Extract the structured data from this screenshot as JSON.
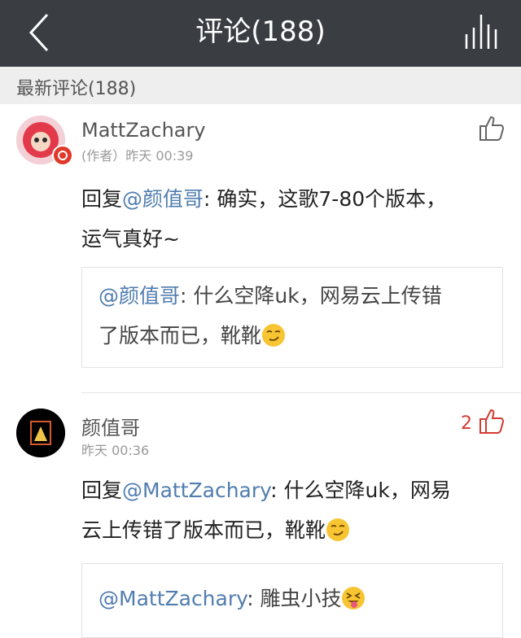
{
  "header": {
    "title": "评论(188)",
    "back_icon": "chevron-left-icon",
    "stats_icon": "bars-icon"
  },
  "section": {
    "label": "最新评论(188)"
  },
  "comments": [
    {
      "username": "MattZachary",
      "meta": "(作者）昨天 00:39",
      "like_count": "",
      "reply_prefix": "回复",
      "reply_mention": "@颜值哥",
      "reply_text_1": ": 确实，这歌7-80个版本，",
      "reply_text_2": "运气真好~",
      "quote_mention": "@颜值哥",
      "quote_text_1": ": 什么空降uk，网易云上传错",
      "quote_text_2": "了版本而已，靴靴",
      "quote_emoji": "smirk-emoji"
    },
    {
      "username": "颜值哥",
      "meta": "昨天 00:36",
      "like_count": "2",
      "reply_prefix": "回复",
      "reply_mention": "@MattZachary",
      "reply_text_1": ": 什么空降uk，网易",
      "reply_text_2": "云上传错了版本而已，靴靴",
      "reply_emoji": "smirk-emoji",
      "quote_mention": "@MattZachary",
      "quote_text_1": ": 雕虫小技",
      "quote_emoji": "tongue-out-emoji"
    }
  ],
  "colors": {
    "topbar": "#3a3d42",
    "mention": "#507daf",
    "like_red": "#d33a31"
  }
}
